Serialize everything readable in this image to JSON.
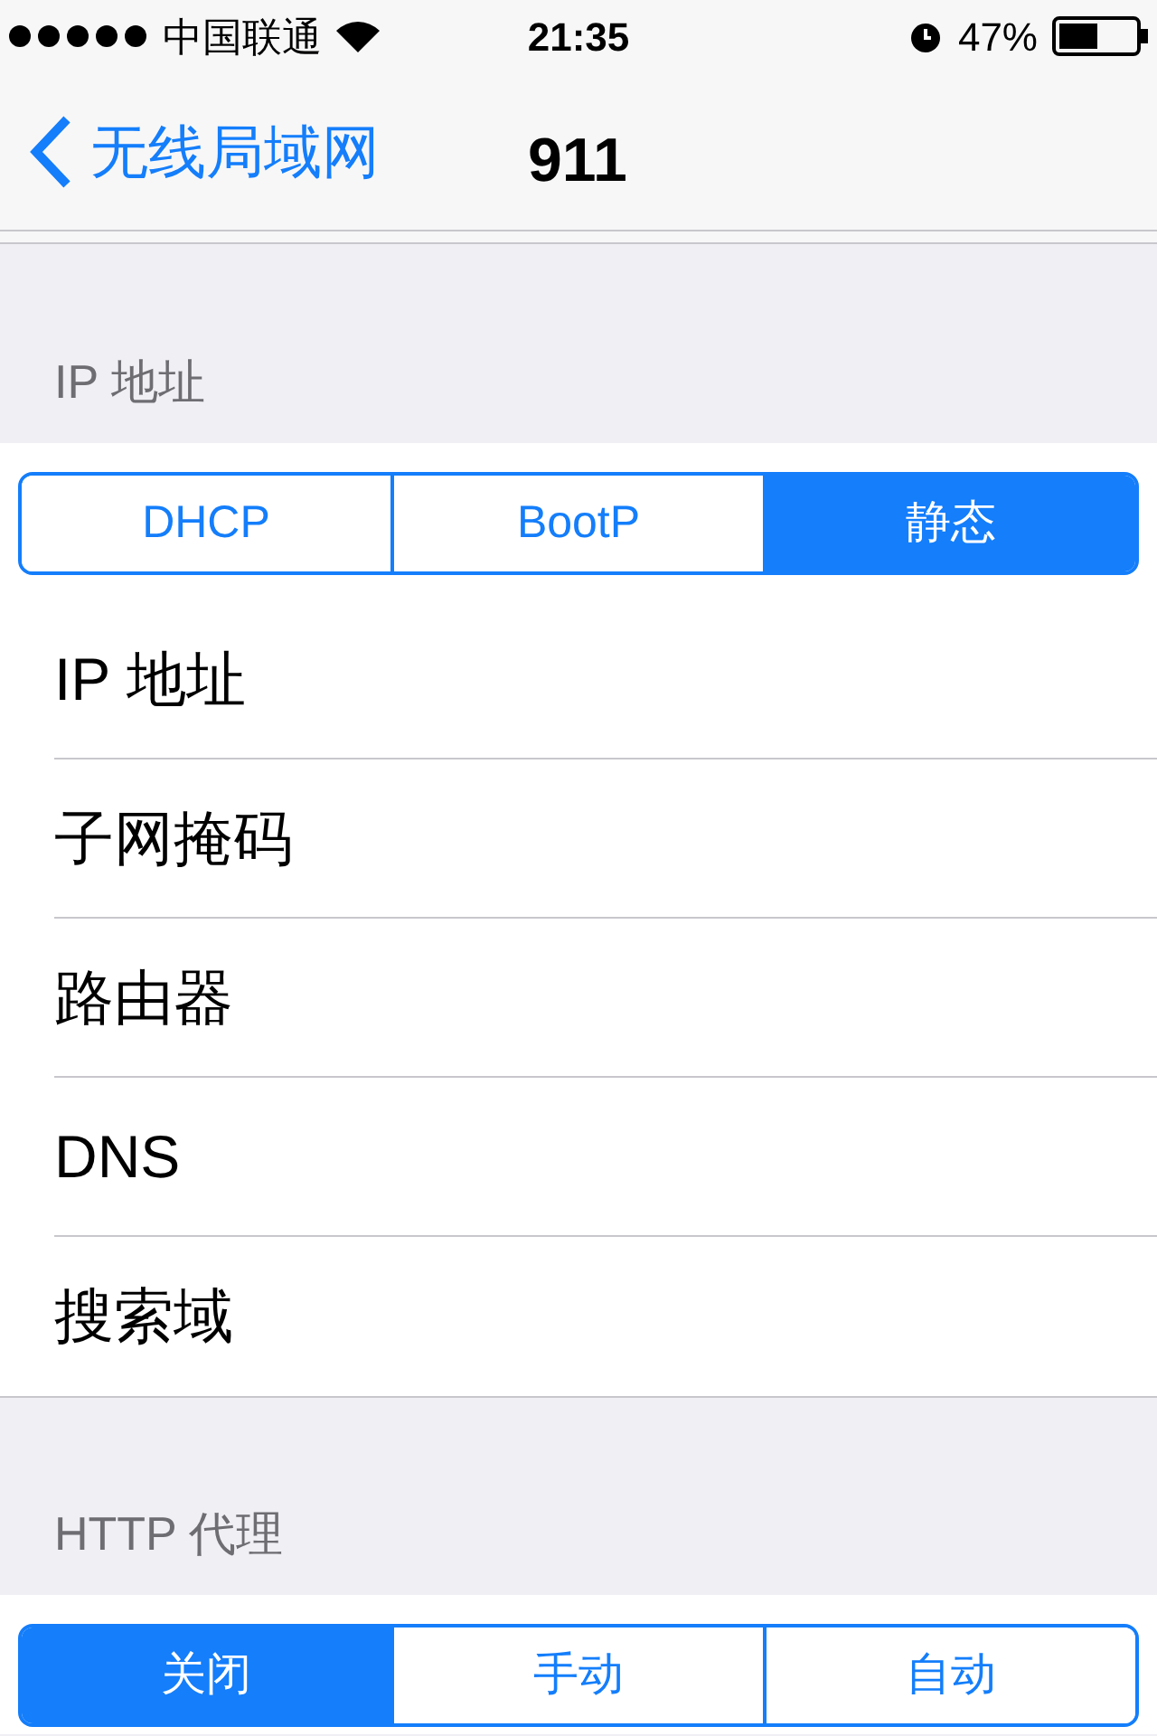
{
  "status_bar": {
    "carrier": "中国联通",
    "time": "21:35",
    "battery": "47%"
  },
  "nav_bar": {
    "back": "无线局域网",
    "title": "911"
  },
  "ip_section": {
    "header": "IP 地址",
    "segments": [
      {
        "label": "DHCP",
        "selected": false
      },
      {
        "label": "BootP",
        "selected": false
      },
      {
        "label": "静态",
        "selected": true
      }
    ],
    "rows": [
      {
        "label": "IP 地址"
      },
      {
        "label": "子网掩码"
      },
      {
        "label": "路由器"
      },
      {
        "label": "DNS"
      },
      {
        "label": "搜索域"
      }
    ]
  },
  "proxy_section": {
    "header": "HTTP 代理",
    "segments": [
      {
        "label": "关闭",
        "selected": true
      },
      {
        "label": "手动",
        "selected": false
      },
      {
        "label": "自动",
        "selected": false
      }
    ]
  }
}
